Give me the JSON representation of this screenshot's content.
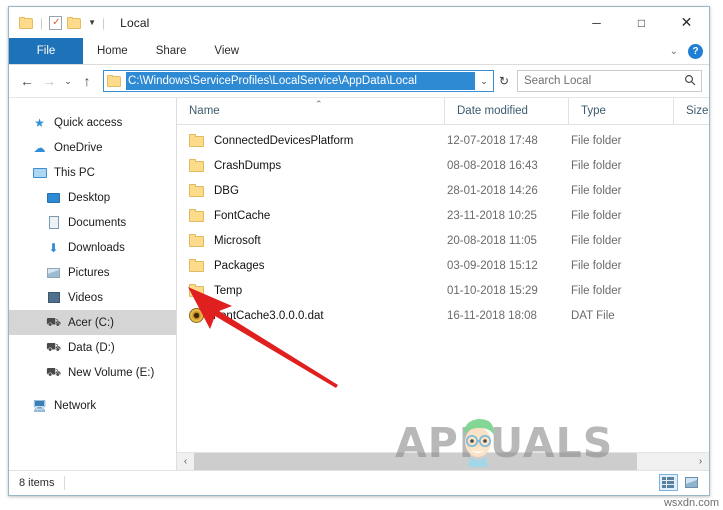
{
  "window": {
    "title": "Local",
    "quick_access_toolbar": [
      {
        "name": "folder-icon",
        "label": ""
      },
      {
        "name": "properties-icon",
        "label": ""
      },
      {
        "name": "new-folder-icon",
        "label": ""
      }
    ],
    "controls": {
      "minimize": "─",
      "maximize": "□",
      "close": "✕"
    }
  },
  "ribbon": {
    "tabs": [
      {
        "label": "File",
        "active": true
      },
      {
        "label": "Home",
        "active": false
      },
      {
        "label": "Share",
        "active": false
      },
      {
        "label": "View",
        "active": false
      }
    ],
    "collapse_chevron": "⌄",
    "help_label": "?"
  },
  "address_bar": {
    "back": "←",
    "forward": "→",
    "recent_chevron": "⌄",
    "up": "↑",
    "path": "C:\\Windows\\ServiceProfiles\\LocalService\\AppData\\Local",
    "dropdown_chevron": "⌄",
    "refresh": "↻"
  },
  "search": {
    "placeholder": "Search Local",
    "icon": "⚲"
  },
  "sidebar": {
    "items": [
      {
        "label": "Quick access",
        "icon": "star-icon",
        "indent": false,
        "selected": false
      },
      {
        "label": "OneDrive",
        "icon": "cloud-icon",
        "indent": false,
        "selected": false
      },
      {
        "label": "This PC",
        "icon": "monitor-icon",
        "indent": false,
        "selected": false
      },
      {
        "label": "Desktop",
        "icon": "desktop-icon",
        "indent": true,
        "selected": false
      },
      {
        "label": "Documents",
        "icon": "documents-icon",
        "indent": true,
        "selected": false
      },
      {
        "label": "Downloads",
        "icon": "downloads-icon",
        "indent": true,
        "selected": false
      },
      {
        "label": "Pictures",
        "icon": "pictures-icon",
        "indent": true,
        "selected": false
      },
      {
        "label": "Videos",
        "icon": "videos-icon",
        "indent": true,
        "selected": false
      },
      {
        "label": "Acer (C:)",
        "icon": "drive-icon",
        "indent": true,
        "selected": true
      },
      {
        "label": "Data (D:)",
        "icon": "drive-icon",
        "indent": true,
        "selected": false
      },
      {
        "label": "New Volume (E:)",
        "icon": "drive-icon",
        "indent": true,
        "selected": false
      },
      {
        "label": "Network",
        "icon": "network-icon",
        "indent": false,
        "selected": false
      }
    ]
  },
  "file_list": {
    "columns": [
      {
        "label": "Name",
        "sorted": "asc"
      },
      {
        "label": "Date modified",
        "sorted": ""
      },
      {
        "label": "Type",
        "sorted": ""
      },
      {
        "label": "Size",
        "sorted": ""
      }
    ],
    "sort_caret": "⌃",
    "rows": [
      {
        "name": "ConnectedDevicesPlatform",
        "date": "12-07-2018 17:48",
        "type": "File folder",
        "size": "",
        "icon": "folder-icon"
      },
      {
        "name": "CrashDumps",
        "date": "08-08-2018 16:43",
        "type": "File folder",
        "size": "",
        "icon": "folder-icon"
      },
      {
        "name": "DBG",
        "date": "28-01-2018 14:26",
        "type": "File folder",
        "size": "",
        "icon": "folder-icon"
      },
      {
        "name": "FontCache",
        "date": "23-11-2018 10:25",
        "type": "File folder",
        "size": "",
        "icon": "folder-icon"
      },
      {
        "name": "Microsoft",
        "date": "20-08-2018 11:05",
        "type": "File folder",
        "size": "",
        "icon": "folder-icon"
      },
      {
        "name": "Packages",
        "date": "03-09-2018 15:12",
        "type": "File folder",
        "size": "",
        "icon": "folder-icon"
      },
      {
        "name": "Temp",
        "date": "01-10-2018 15:29",
        "type": "File folder",
        "size": "",
        "icon": "folder-icon"
      },
      {
        "name": "FontCache3.0.0.0.dat",
        "date": "16-11-2018 18:08",
        "type": "DAT File",
        "size": "",
        "icon": "dat-icon"
      }
    ]
  },
  "scrollbar": {
    "left_arrow": "‹",
    "right_arrow": "›"
  },
  "status_bar": {
    "item_count": "8 items",
    "view_details_label": "",
    "view_icons_label": ""
  },
  "annotations": {
    "arrow_color": "#e01f1f",
    "watermark_text": "APPUALS",
    "site_watermark": "wsxdn.com"
  }
}
